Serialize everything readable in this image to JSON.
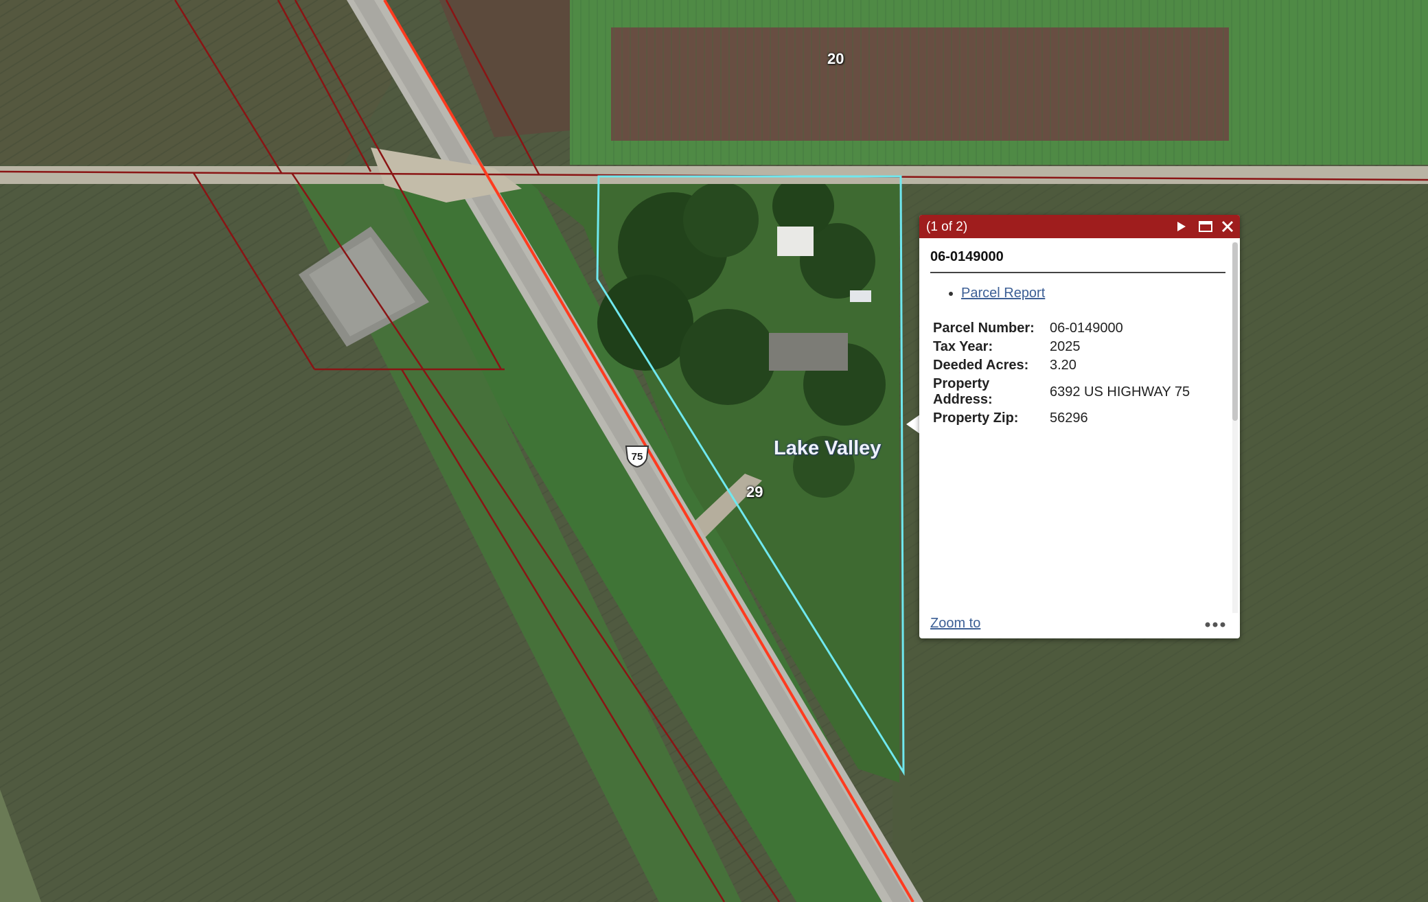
{
  "map": {
    "lot_labels": [
      "20",
      "29"
    ],
    "place_label": "Lake Valley",
    "route_shield": "75",
    "colors": {
      "selection_outline": "#6fe8ef",
      "parcel_line": "#8a1414",
      "highway_centerline": "#ff3b1f",
      "road": "#c8bfae"
    }
  },
  "popup": {
    "counter": "(1 of 2)",
    "icons": {
      "next": "play-icon",
      "maximize": "maximize-icon",
      "close": "close-icon",
      "more": "more-icon"
    },
    "title": "06-0149000",
    "links": [
      "Parcel Report"
    ],
    "attributes": [
      {
        "label": "Parcel Number:",
        "value": "06-0149000"
      },
      {
        "label": "Tax Year:",
        "value": "2025"
      },
      {
        "label": "Deeded Acres:",
        "value": "3.20"
      },
      {
        "label": "Property Address:",
        "value": "6392 US HIGHWAY 75"
      },
      {
        "label": "Property Zip:",
        "value": "56296"
      }
    ],
    "footer": {
      "zoom_label": "Zoom to"
    },
    "header_color": "#9f1d1d"
  }
}
